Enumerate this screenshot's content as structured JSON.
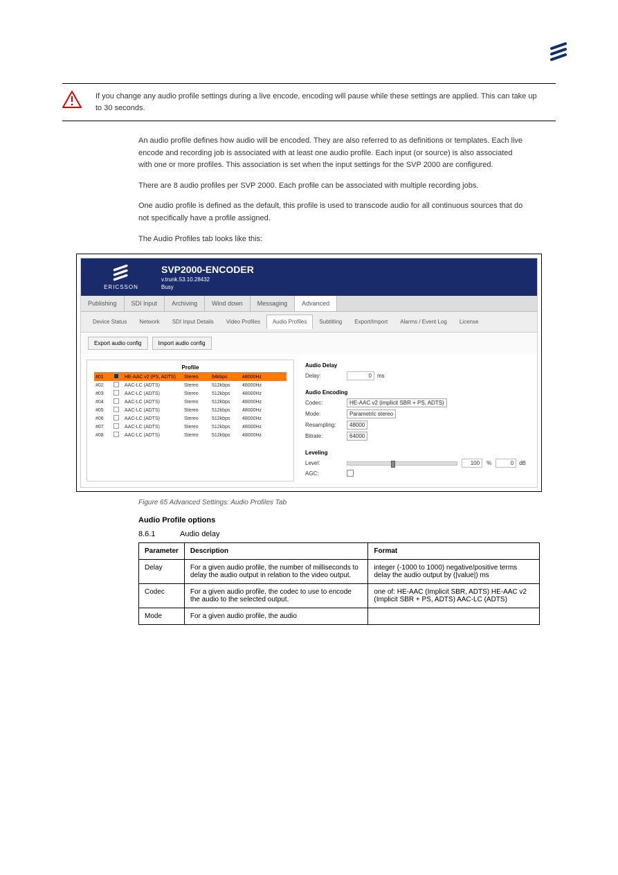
{
  "logo_top_alt": "Ericsson logo",
  "warning_text": "If you change any audio profile settings during a live encode, encoding will pause while these settings are applied. This can take up to 30 seconds.",
  "intro_paragraphs": [
    "An audio profile defines how audio will be encoded. They are also referred to as definitions or templates. Each live encode and recording job is associated with at least one audio profile. Each input (or source) is also associated with one or more profiles. This association is set when the input settings for the SVP 2000 are configured.",
    "There are 8 audio profiles per SVP 2000. Each profile can be associated with multiple recording jobs.",
    "One audio profile is defined as the default, this profile is used to transcode audio for all continuous sources that do not specifically have a profile assigned.",
    "The Audio Profiles tab looks like this:"
  ],
  "app": {
    "title": "SVP2000-ENCODER",
    "version": "v.trunk.53.10.28432",
    "status": "Busy",
    "logo_text": "ERICSSON",
    "main_tabs": [
      "Publishing",
      "SDI Input",
      "Archiving",
      "Wind down",
      "Messaging",
      "Advanced"
    ],
    "main_tab_active": "Advanced",
    "sub_tabs": [
      "Device Status",
      "Network",
      "SDI Input Details",
      "Video Profiles",
      "Audio Profiles",
      "Subtitling",
      "Export/Import",
      "Alarms / Event Log",
      "License"
    ],
    "sub_tab_active": "Audio Profiles",
    "toolbar": {
      "export": "Export audio config",
      "import": "Import audio config"
    },
    "profile_table": {
      "header": "Profile",
      "rows": [
        {
          "id": "#01",
          "checked": true,
          "selected": true,
          "codec": "HE-AAC v2 (PS, ADTS)",
          "mode": "Stereo",
          "bitrate": "64kbps",
          "rate": "48000Hz"
        },
        {
          "id": "#02",
          "checked": false,
          "selected": false,
          "codec": "AAC-LC (ADTS)",
          "mode": "Stereo",
          "bitrate": "512kbps",
          "rate": "48000Hz"
        },
        {
          "id": "#03",
          "checked": false,
          "selected": false,
          "codec": "AAC-LC (ADTS)",
          "mode": "Stereo",
          "bitrate": "512kbps",
          "rate": "48000Hz"
        },
        {
          "id": "#04",
          "checked": false,
          "selected": false,
          "codec": "AAC-LC (ADTS)",
          "mode": "Stereo",
          "bitrate": "512kbps",
          "rate": "48000Hz"
        },
        {
          "id": "#05",
          "checked": false,
          "selected": false,
          "codec": "AAC-LC (ADTS)",
          "mode": "Stereo",
          "bitrate": "512kbps",
          "rate": "48000Hz"
        },
        {
          "id": "#06",
          "checked": false,
          "selected": false,
          "codec": "AAC-LC (ADTS)",
          "mode": "Stereo",
          "bitrate": "512kbps",
          "rate": "48000Hz"
        },
        {
          "id": "#07",
          "checked": false,
          "selected": false,
          "codec": "AAC-LC (ADTS)",
          "mode": "Stereo",
          "bitrate": "512kbps",
          "rate": "48000Hz"
        },
        {
          "id": "#08",
          "checked": false,
          "selected": false,
          "codec": "AAC-LC (ADTS)",
          "mode": "Stereo",
          "bitrate": "512kbps",
          "rate": "48000Hz"
        }
      ]
    },
    "right": {
      "audio_delay": {
        "title": "Audio Delay",
        "label": "Delay:",
        "value": "0",
        "unit": "ms"
      },
      "audio_encoding": {
        "title": "Audio Encoding",
        "codec_label": "Codec:",
        "codec_value": "HE-AAC v2 (implicit SBR + PS, ADTS)",
        "mode_label": "Mode:",
        "mode_value": "Parametric stereo",
        "resampling_label": "Resampling:",
        "resampling_value": "48000",
        "bitrate_label": "Bitrate:",
        "bitrate_value": "64000"
      },
      "leveling": {
        "title": "Leveling",
        "level_label": "Level:",
        "level_pct": "100",
        "pct_unit": "%",
        "db_value": "0",
        "db_unit": "dB",
        "agc_label": "AGC:"
      }
    }
  },
  "figure_caption": "Figure 65 Advanced Settings: Audio Profiles Tab",
  "options_heading": "Audio Profile options",
  "section": {
    "num": "8.6.1",
    "title": "Audio delay"
  },
  "table": {
    "headers": [
      "Parameter",
      "Description",
      "Format"
    ],
    "rows": [
      [
        "Delay",
        "For a given audio profile, the number of milliseconds to delay the audio output in relation to the video output.",
        "integer (-1000 to 1000) negative/positive terms delay the audio output by (|value|) ms"
      ],
      [
        "Codec",
        "For a given audio profile, the codec to use to encode the audio to the selected output.",
        "one of: HE-AAC (Implicit SBR, ADTS) HE-AAC v2 (Implicit SBR + PS, ADTS) AAC-LC (ADTS)"
      ],
      [
        "Mode",
        "For a given audio profile, the audio",
        ""
      ]
    ]
  }
}
